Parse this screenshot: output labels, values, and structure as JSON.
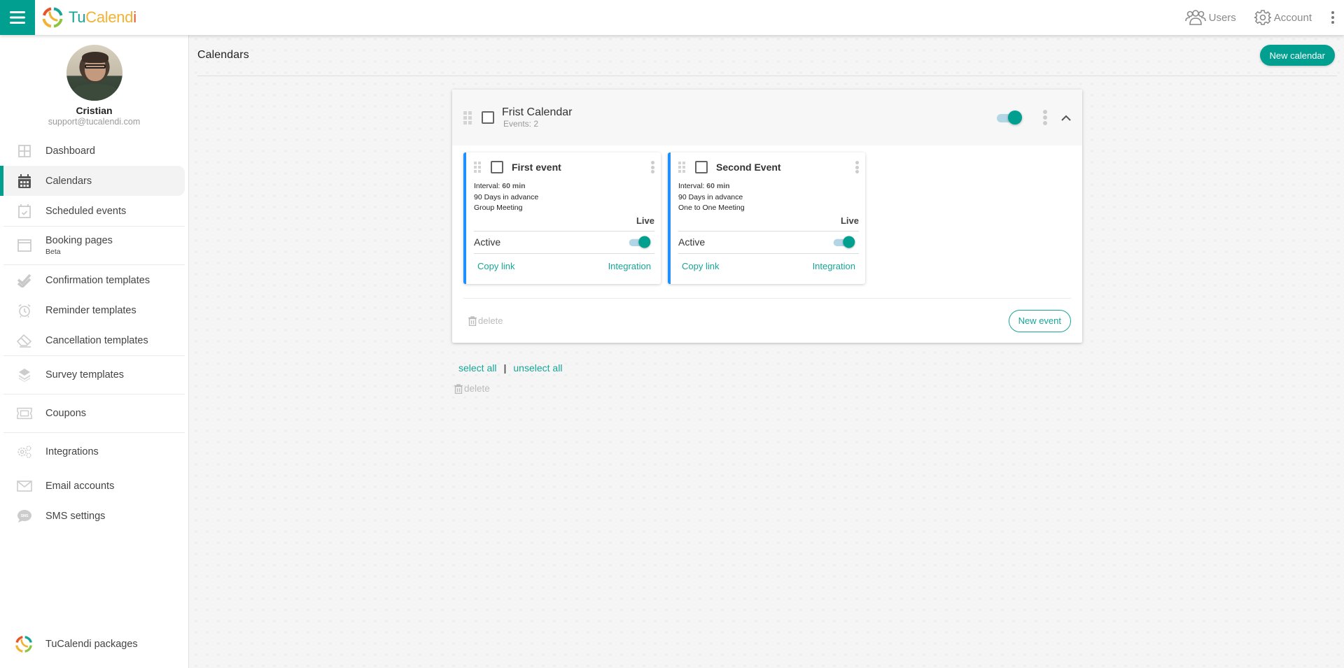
{
  "app": {
    "brand_parts": [
      "Tu",
      "Calend",
      "i"
    ],
    "brand_colors": {
      "teal": "#16a596",
      "yellow": "#f2b232",
      "red": "#e8542a"
    },
    "accent": "#009f8f"
  },
  "topbar": {
    "menu_icon": "hamburger-icon",
    "users_label": "Users",
    "account_label": "Account"
  },
  "profile": {
    "name": "Cristian",
    "email": "support@tucalendi.com"
  },
  "sidebar": {
    "items": [
      {
        "label": "Dashboard",
        "icon": "dashboard-icon"
      },
      {
        "label": "Calendars",
        "icon": "calendar-icon",
        "active": true
      },
      {
        "label": "Scheduled events",
        "icon": "calendar-check-icon"
      },
      {
        "label": "Booking pages",
        "sub": "Beta",
        "icon": "browser-window-icon"
      },
      {
        "label": "Confirmation templates",
        "icon": "double-check-icon"
      },
      {
        "label": "Reminder templates",
        "icon": "alarm-clock-icon"
      },
      {
        "label": "Cancellation templates",
        "icon": "eraser-icon"
      },
      {
        "label": "Survey templates",
        "icon": "layers-icon"
      },
      {
        "label": "Coupons",
        "icon": "ticket-icon"
      },
      {
        "label": "Integrations",
        "icon": "gears-icon"
      },
      {
        "label": "Email accounts",
        "icon": "envelope-icon"
      },
      {
        "label": "SMS settings",
        "icon": "sms-bubble-icon"
      }
    ],
    "packages_label": "TuCalendi packages"
  },
  "page": {
    "title": "Calendars",
    "new_calendar_label": "New calendar"
  },
  "calendar": {
    "title": "Frist Calendar",
    "events_count": "Events: 2",
    "enabled": true,
    "events": [
      {
        "title": "First event",
        "interval_label": "Interval:",
        "interval_value": "60 min",
        "advance": "90 Days in advance",
        "type": "Group Meeting",
        "status": "Live",
        "active_label": "Active",
        "active": true,
        "copy_link_label": "Copy link",
        "integration_label": "Integration"
      },
      {
        "title": "Second Event",
        "interval_label": "Interval:",
        "interval_value": "60 min",
        "advance": "90 Days in advance",
        "type": "One to One Meeting",
        "status": "Live",
        "active_label": "Active",
        "active": true,
        "copy_link_label": "Copy link",
        "integration_label": "Integration"
      }
    ],
    "delete_label": "delete",
    "new_event_label": "New event"
  },
  "bulk": {
    "select_all": "select all",
    "separator": "|",
    "unselect_all": "unselect all",
    "delete_label": "delete"
  }
}
